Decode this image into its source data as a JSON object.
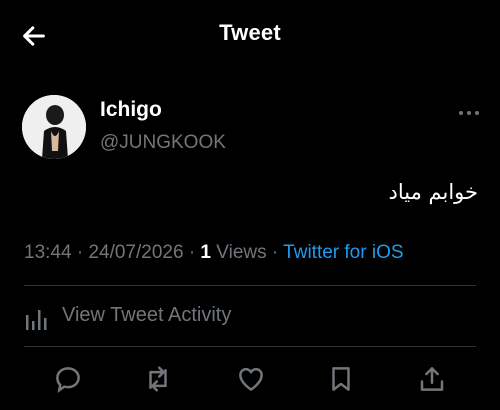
{
  "header": {
    "title": "Tweet",
    "back_icon": "arrow-left-icon"
  },
  "author": {
    "name": "Ichigo",
    "handle": "@JUNGKOOK"
  },
  "tweet": {
    "text": "خوابم میاد"
  },
  "meta": {
    "time": "13:44",
    "sep1": "·",
    "date": "24/07/2026",
    "sep2": "·",
    "views_count": "1",
    "views_label": "Views",
    "sep3": "·",
    "source": "Twitter for iOS"
  },
  "activity": {
    "label": "View Tweet Activity",
    "icon": "bar-chart-icon"
  },
  "actions": [
    "reply-icon",
    "retweet-icon",
    "like-icon",
    "bookmark-icon",
    "share-icon"
  ],
  "colors": {
    "accent": "#1d9bf0",
    "muted": "#71767b",
    "divider": "#2f3336",
    "background": "#000000"
  }
}
